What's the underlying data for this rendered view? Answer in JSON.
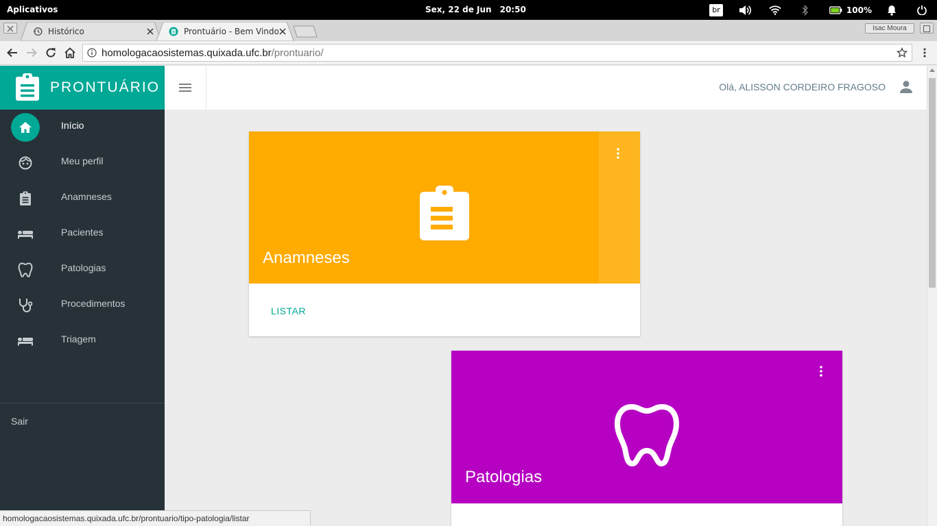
{
  "os_panel": {
    "apps_label": "Aplicativos",
    "date": "Sex, 22 de Jun",
    "time": "20:50",
    "keyboard_layout": "br",
    "battery": "100%"
  },
  "browser": {
    "tabs": [
      {
        "title": "Histórico",
        "active": false
      },
      {
        "title": "Prontuário - Bem Vindo",
        "active": true
      }
    ],
    "profile_name": "Isac Moura",
    "url_host": "homologacaosistemas.quixada.ufc.br",
    "url_path": "/prontuario/",
    "status_url": "homologacaosistemas.quixada.ufc.br/prontuario/tipo-patologia/listar"
  },
  "app": {
    "brand": "PRONTUÁRIO",
    "greeting": "Olá, ALISSON CORDEIRO FRAGOSO",
    "accent_color": "#00a896",
    "sidebar_bg": "#263238",
    "sidebar": {
      "items": [
        {
          "label": "Início",
          "icon": "home-icon",
          "active": true
        },
        {
          "label": "Meu perfil",
          "icon": "face-icon",
          "active": false
        },
        {
          "label": "Anamneses",
          "icon": "clipboard-icon",
          "active": false
        },
        {
          "label": "Pacientes",
          "icon": "bed-icon",
          "active": false
        },
        {
          "label": "Patologias",
          "icon": "tooth-icon",
          "active": false
        },
        {
          "label": "Procedimentos",
          "icon": "stethoscope-icon",
          "active": false
        },
        {
          "label": "Triagem",
          "icon": "bed-icon",
          "active": false
        }
      ],
      "logout": "Sair"
    },
    "cards": [
      {
        "title": "Anamneses",
        "action": "LISTAR",
        "color": "#ffab00",
        "icon": "clipboard-icon"
      },
      {
        "title": "Patologias",
        "action": "",
        "color": "#b600c2",
        "icon": "tooth-icon"
      }
    ]
  }
}
